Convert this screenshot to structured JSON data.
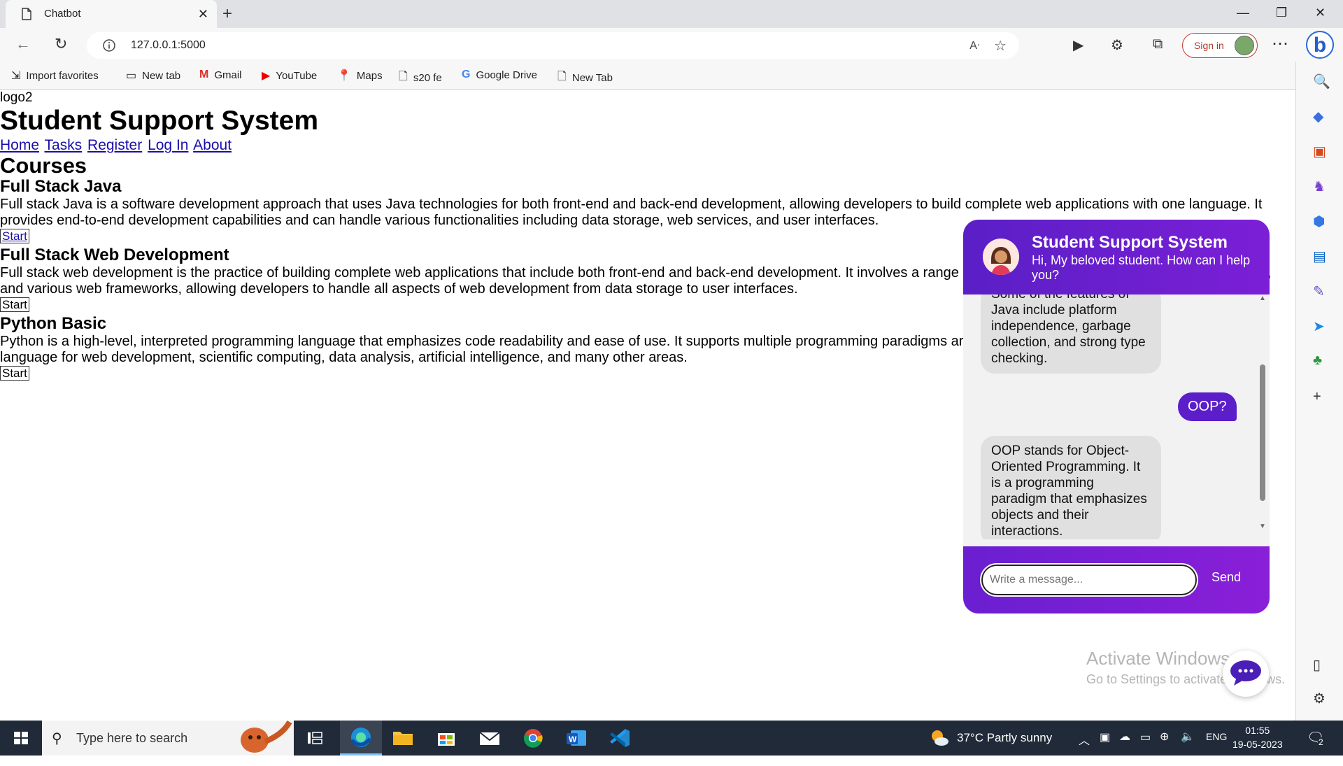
{
  "browser": {
    "tab_title": "Chatbot",
    "url": "127.0.0.1:5000",
    "signin_label": "Sign in",
    "bookmarks": [
      "Import favorites",
      "New tab",
      "Gmail",
      "YouTube",
      "Maps",
      "s20 fe",
      "Google Drive",
      "New Tab"
    ]
  },
  "page": {
    "logo_alt": "logo2",
    "site_title": "Student Support System",
    "nav": [
      "Home",
      "Tasks",
      "Register",
      "Log In",
      "About"
    ],
    "courses_heading": "Courses",
    "courses": [
      {
        "title": "Full Stack Java",
        "description": "Full stack Java is a software development approach that uses Java technologies for both front-end and back-end development, allowing developers to build complete web applications with one language. It provides end-to-end development capabilities and can handle various functionalities including data storage, web services, and user interfaces.",
        "button": "Start"
      },
      {
        "title": "Full Stack Web Development",
        "description": "Full stack web development is the practice of building complete web applications that include both front-end and back-end development. It involves a range",
        "description_tail": ",",
        "description_line2": "and various web frameworks, allowing developers to handle all aspects of web development from data storage to user interfaces.",
        "button": "Start"
      },
      {
        "title": "Python Basic",
        "description": "Python is a high-level, interpreted programming language that emphasizes code readability and ease of use. It supports multiple programming paradigms ar",
        "description_line2": "language for web development, scientific computing, data analysis, artificial intelligence, and many other areas.",
        "button": "Start"
      }
    ]
  },
  "chat": {
    "title": "Student Support System",
    "subtitle": "Hi, My beloved student. How can I help you?",
    "messages": [
      {
        "from": "bot",
        "text": "Some of the features of Java include platform independence, garbage collection, and strong type checking."
      },
      {
        "from": "user",
        "text": "OOP?"
      },
      {
        "from": "bot",
        "text": "OOP stands for Object-Oriented Programming. It is a programming paradigm that emphasizes objects and their interactions."
      }
    ],
    "input_placeholder": "Write a message...",
    "send_label": "Send"
  },
  "watermark": {
    "line1": "Activate Windows",
    "line2": "Go to Settings to activate Windows."
  },
  "taskbar": {
    "search_placeholder": "Type here to search",
    "weather": "37°C  Partly sunny",
    "language": "ENG",
    "time": "01:55",
    "date": "19-05-2023",
    "notification_count": "2"
  },
  "colors": {
    "chat_header": "#5a1fc6",
    "user_bubble": "#5b1ec9",
    "bot_bubble": "#e0e0e0",
    "link": "#1a0dab"
  }
}
